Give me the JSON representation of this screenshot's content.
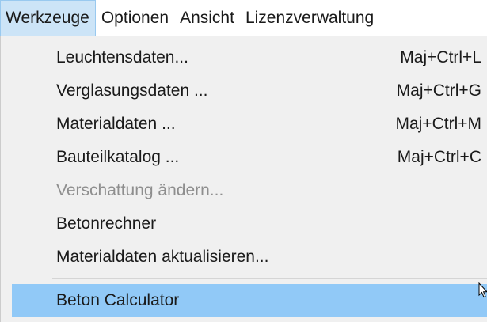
{
  "menubar": {
    "items": [
      {
        "label": "Werkzeuge"
      },
      {
        "label": "Optionen"
      },
      {
        "label": "Ansicht"
      },
      {
        "label": "Lizenzverwaltung"
      }
    ]
  },
  "menu": {
    "items": [
      {
        "label": "Leuchtensdaten...",
        "shortcut": "Maj+Ctrl+L"
      },
      {
        "label": "Verglasungsdaten ...",
        "shortcut": "Maj+Ctrl+G"
      },
      {
        "label": "Materialdaten ...",
        "shortcut": "Maj+Ctrl+M"
      },
      {
        "label": "Bauteilkatalog ...",
        "shortcut": "Maj+Ctrl+C"
      },
      {
        "label": "Verschattung ändern...",
        "disabled": true
      },
      {
        "label": "Betonrechner"
      },
      {
        "label": "Materialdaten aktualisieren..."
      },
      {
        "label": "Beton Calculator",
        "highlighted": true
      }
    ]
  },
  "colors": {
    "menubar_active_bg": "#cce4f7",
    "highlight_bg": "#91c9f7",
    "disabled_text": "#8e8e8e",
    "dropdown_bg": "#f0f0f0"
  }
}
